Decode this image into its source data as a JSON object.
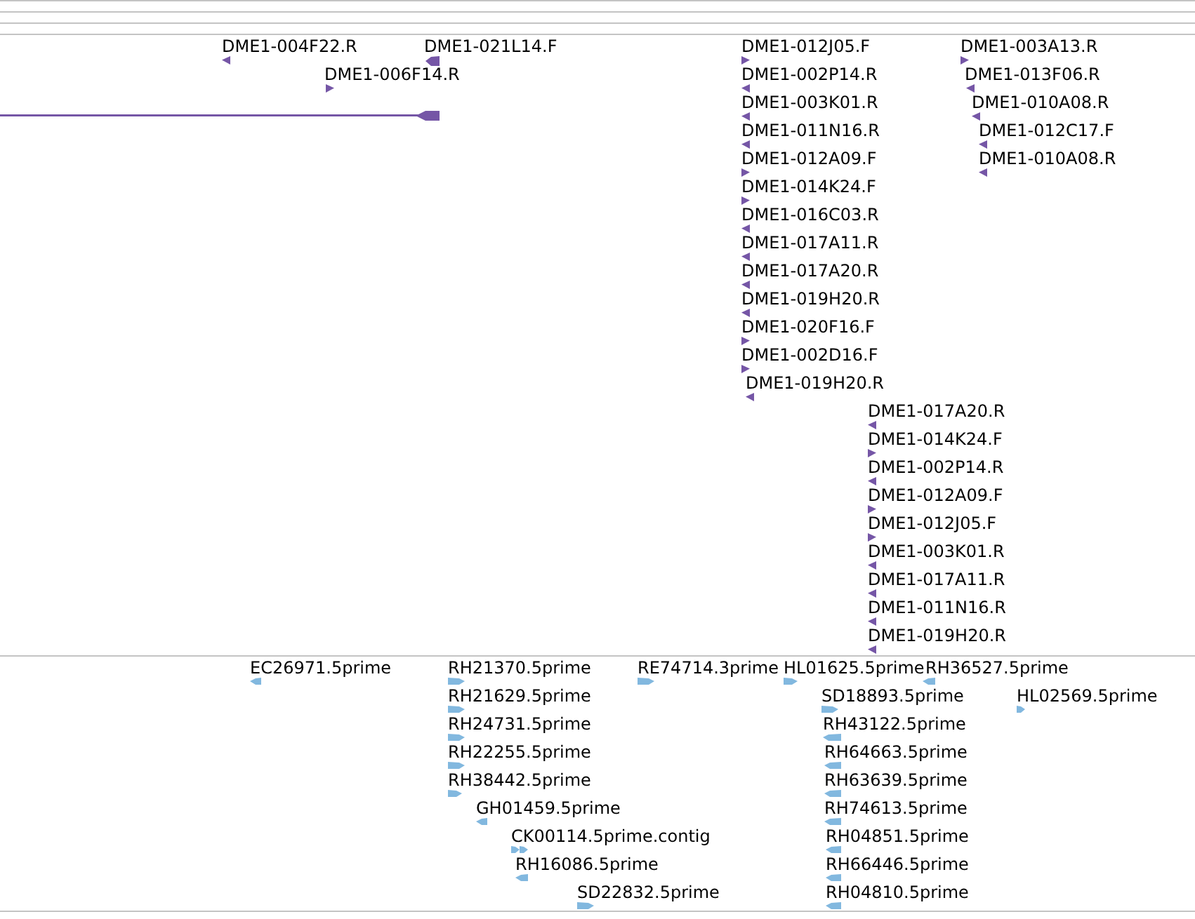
{
  "tracks": [
    {
      "kind": "clone_ends",
      "span_feature": {
        "reverse": true
      },
      "features": [
        {
          "label": "DME1-004F22.R",
          "reverse": true
        },
        {
          "label": "DME1-021L14.F",
          "reverse": true
        },
        {
          "label": "DME1-012J05.F",
          "reverse": false
        },
        {
          "label": "DME1-003A13.R",
          "reverse": false
        },
        {
          "label": "DME1-006F14.R",
          "reverse": false
        },
        {
          "label": "DME1-002P14.R",
          "reverse": true
        },
        {
          "label": "DME1-013F06.R",
          "reverse": true
        },
        {
          "label": "DME1-003K01.R",
          "reverse": true
        },
        {
          "label": "DME1-010A08.R",
          "reverse": true
        },
        {
          "label": "DME1-011N16.R",
          "reverse": true
        },
        {
          "label": "DME1-012C17.F",
          "reverse": true
        },
        {
          "label": "DME1-012A09.F",
          "reverse": false
        },
        {
          "label": "DME1-010A08.R",
          "reverse": true
        },
        {
          "label": "DME1-014K24.F",
          "reverse": false
        },
        {
          "label": "DME1-016C03.R",
          "reverse": true
        },
        {
          "label": "DME1-017A11.R",
          "reverse": true
        },
        {
          "label": "DME1-017A20.R",
          "reverse": true
        },
        {
          "label": "DME1-019H20.R",
          "reverse": true
        },
        {
          "label": "DME1-020F16.F",
          "reverse": false
        },
        {
          "label": "DME1-002D16.F",
          "reverse": false
        },
        {
          "label": "DME1-019H20.R",
          "reverse": true
        },
        {
          "label": "DME1-017A20.R",
          "reverse": true
        },
        {
          "label": "DME1-014K24.F",
          "reverse": false
        },
        {
          "label": "DME1-002P14.R",
          "reverse": true
        },
        {
          "label": "DME1-012A09.F",
          "reverse": false
        },
        {
          "label": "DME1-012J05.F",
          "reverse": false
        },
        {
          "label": "DME1-003K01.R",
          "reverse": true
        },
        {
          "label": "DME1-017A11.R",
          "reverse": true
        },
        {
          "label": "DME1-011N16.R",
          "reverse": true
        },
        {
          "label": "DME1-019H20.R",
          "reverse": true
        }
      ]
    },
    {
      "kind": "est",
      "features": [
        {
          "label": "EC26971.5prime",
          "reverse": true,
          "kind": "single"
        },
        {
          "label": "RH21370.5prime",
          "reverse": false,
          "kind": "single"
        },
        {
          "label": "RE74714.3prime",
          "reverse": false,
          "kind": "single"
        },
        {
          "label": "HL01625.5prime",
          "reverse": false,
          "kind": "single"
        },
        {
          "label": "RH36527.5prime",
          "reverse": true,
          "kind": "single"
        },
        {
          "label": "RH21629.5prime",
          "reverse": false,
          "kind": "single"
        },
        {
          "label": "SD18893.5prime",
          "reverse": false,
          "kind": "single"
        },
        {
          "label": "HL02569.5prime",
          "reverse": false,
          "kind": "single"
        },
        {
          "label": "RH24731.5prime",
          "reverse": false,
          "kind": "single"
        },
        {
          "label": "RH43122.5prime",
          "reverse": true,
          "kind": "single"
        },
        {
          "label": "RH22255.5prime",
          "reverse": false,
          "kind": "single"
        },
        {
          "label": "RH64663.5prime",
          "reverse": true,
          "kind": "single"
        },
        {
          "label": "RH38442.5prime",
          "reverse": false,
          "kind": "single"
        },
        {
          "label": "RH63639.5prime",
          "reverse": true,
          "kind": "single"
        },
        {
          "label": "GH01459.5prime",
          "reverse": true,
          "kind": "single"
        },
        {
          "label": "RH74613.5prime",
          "reverse": true,
          "kind": "single"
        },
        {
          "label": "CK00114.5prime.contig",
          "reverse": false,
          "kind": "contig"
        },
        {
          "label": "RH04851.5prime",
          "reverse": true,
          "kind": "single"
        },
        {
          "label": "RH16086.5prime",
          "reverse": true,
          "kind": "single"
        },
        {
          "label": "RH66446.5prime",
          "reverse": true,
          "kind": "single"
        },
        {
          "label": "SD22832.5prime",
          "reverse": false,
          "kind": "single"
        },
        {
          "label": "RH04810.5prime",
          "reverse": true,
          "kind": "single"
        }
      ]
    }
  ]
}
